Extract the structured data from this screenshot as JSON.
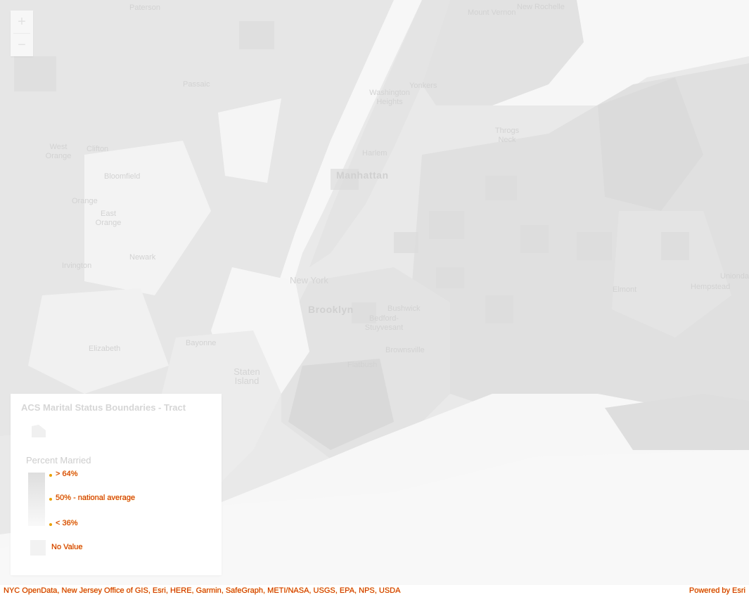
{
  "map": {
    "places": [
      {
        "id": "paterson",
        "label": "Paterson"
      },
      {
        "id": "passaic",
        "label": "Passaic"
      },
      {
        "id": "clifton",
        "label": "Clifton"
      },
      {
        "id": "west-orange",
        "label": "West Orange"
      },
      {
        "id": "bloomfield",
        "label": "Bloomfield"
      },
      {
        "id": "orange",
        "label": "Orange"
      },
      {
        "id": "east-orange",
        "label": "East Orange"
      },
      {
        "id": "newark",
        "label": "Newark"
      },
      {
        "id": "irvington",
        "label": "Irvington"
      },
      {
        "id": "elizabeth",
        "label": "Elizabeth"
      },
      {
        "id": "bayonne",
        "label": "Bayonne"
      },
      {
        "id": "staten-island",
        "label": "Staten Island"
      },
      {
        "id": "new-york",
        "label": "New York"
      },
      {
        "id": "manhattan",
        "label": "Manhattan"
      },
      {
        "id": "harlem",
        "label": "Harlem"
      },
      {
        "id": "washington-heights",
        "label": "Washington Heights"
      },
      {
        "id": "yonkers",
        "label": "Yonkers"
      },
      {
        "id": "mount-vernon",
        "label": "Mount Vernon"
      },
      {
        "id": "new-rochelle",
        "label": "New Rochelle"
      },
      {
        "id": "throgs-neck",
        "label": "Throgs Neck"
      },
      {
        "id": "brooklyn",
        "label": "Brooklyn"
      },
      {
        "id": "bushwick",
        "label": "Bushwick"
      },
      {
        "id": "bedford-stuyvesant",
        "label": "Bedford-Stuyvesant"
      },
      {
        "id": "brownsville",
        "label": "Brownsville"
      },
      {
        "id": "flatbush",
        "label": "Flatbush"
      },
      {
        "id": "elmont",
        "label": "Elmont"
      },
      {
        "id": "hempstead",
        "label": "Hempstead"
      },
      {
        "id": "uniondale",
        "label": "Uniondale"
      }
    ]
  },
  "zoom": {
    "in_label": "+",
    "out_label": "−"
  },
  "legend": {
    "title": "ACS Marital Status Boundaries - Tract",
    "field_label": "Percent Married",
    "ramp": [
      {
        "label": "> 64%"
      },
      {
        "label": "50% - national average"
      },
      {
        "label": "< 36%"
      }
    ],
    "no_value_label": "No Value",
    "ramp_top_color": "#dedede",
    "ramp_bottom_color": "#f9f9f9"
  },
  "attribution": {
    "sources": "NYC OpenData, New Jersey Office of GIS, Esri, HERE, Garmin, SafeGraph, METI/NASA, USGS, EPA, NPS, USDA",
    "powered_by": "Powered by Esri"
  }
}
